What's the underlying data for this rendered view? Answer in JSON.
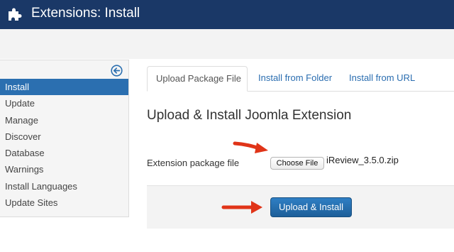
{
  "header": {
    "title": "Extensions: Install",
    "icon": "puzzle-icon"
  },
  "sidebar": {
    "collapse_icon": "arrow-left-circle-icon",
    "items": [
      {
        "label": "Install",
        "active": true
      },
      {
        "label": "Update"
      },
      {
        "label": "Manage"
      },
      {
        "label": "Discover"
      },
      {
        "label": "Database"
      },
      {
        "label": "Warnings"
      },
      {
        "label": "Install Languages"
      },
      {
        "label": "Update Sites"
      }
    ]
  },
  "tabs": [
    {
      "label": "Upload Package File",
      "active": true
    },
    {
      "label": "Install from Folder"
    },
    {
      "label": "Install from URL"
    }
  ],
  "main": {
    "heading": "Upload & Install Joomla Extension",
    "field_label": "Extension package file",
    "choose_file_label": "Choose File",
    "file_name": "iReview_3.5.0.zip",
    "upload_button_label": "Upload & Install"
  },
  "colors": {
    "header_bg": "#1a3867",
    "active_blue": "#2b6fb0",
    "button_blue": "#2f7fc4",
    "arrow_red": "#e03418"
  }
}
